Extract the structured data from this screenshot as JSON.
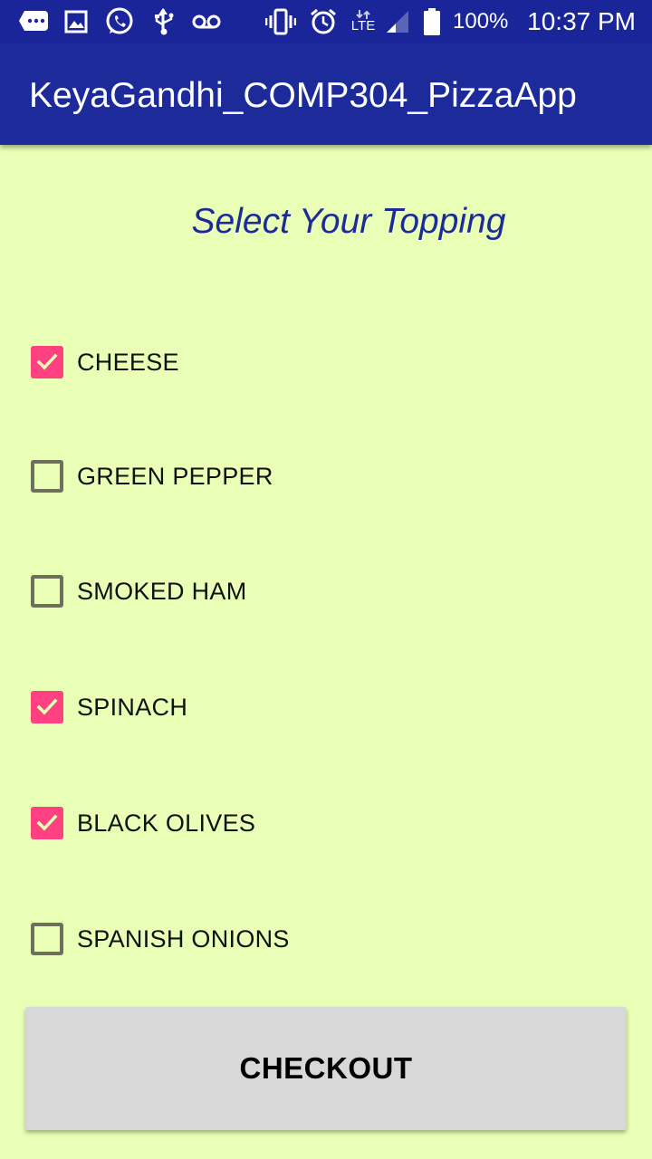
{
  "status_bar": {
    "icons": [
      "chat-bubble-icon",
      "image-icon",
      "whatsapp-icon",
      "usb-icon",
      "voicemail-icon",
      "vibrate-icon",
      "alarm-icon",
      "lte-signal-icon",
      "cell-signal-icon",
      "battery-icon"
    ],
    "network": "LTE",
    "battery": "100%",
    "time": "10:37 PM"
  },
  "app_bar": {
    "title": "KeyaGandhi_COMP304_PizzaApp"
  },
  "heading": "Select Your Topping",
  "toppings": [
    {
      "label": "CHEESE",
      "checked": true
    },
    {
      "label": "GREEN PEPPER",
      "checked": false
    },
    {
      "label": "SMOKED HAM",
      "checked": false
    },
    {
      "label": "SPINACH",
      "checked": true
    },
    {
      "label": "BLACK OLIVES",
      "checked": true
    },
    {
      "label": "SPANISH ONIONS",
      "checked": false
    }
  ],
  "checkout_label": "CHECKOUT",
  "colors": {
    "background": "#e9ffb5",
    "app_bar": "#1d2b9a",
    "accent": "#ff4081",
    "heading": "#1d2b9a",
    "button": "#d7d8d7"
  }
}
